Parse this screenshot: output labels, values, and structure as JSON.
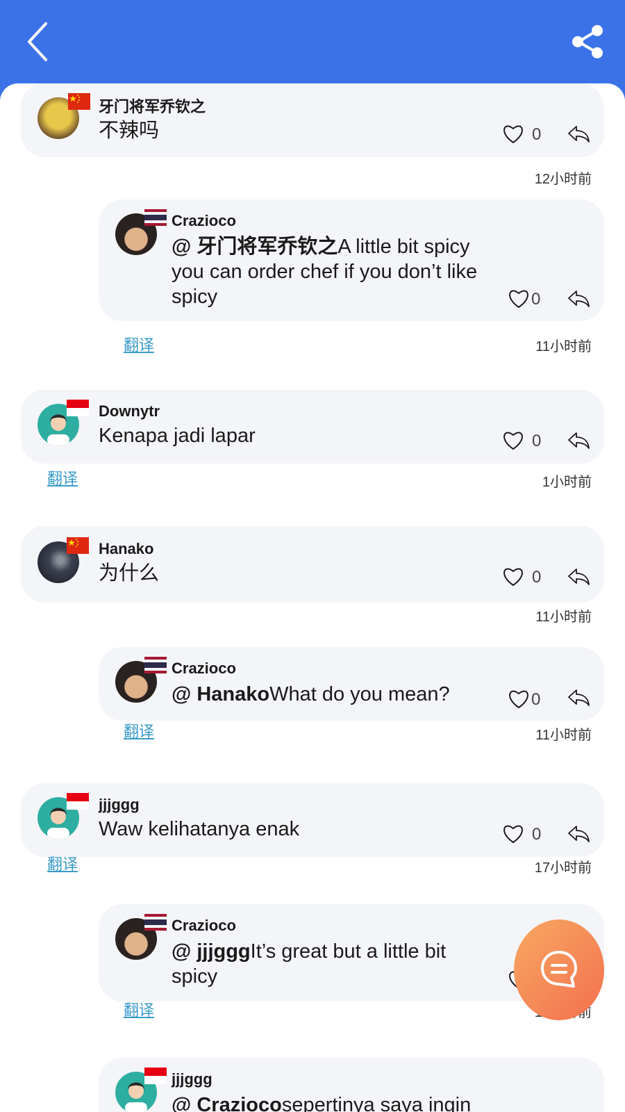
{
  "comments": [
    {
      "username": "牙门将军乔钦之",
      "text": "不辣吗",
      "likes": "0",
      "time": "12小时前"
    },
    {
      "username": "Crazioco",
      "mention": "@ 牙门将军乔钦之",
      "text": "A little bit spicy you can order chef if you don’t like spicy",
      "likes": "0",
      "translate": "翻译",
      "time": "11小时前"
    },
    {
      "username": "Downytr",
      "text": "Kenapa jadi lapar",
      "likes": "0",
      "translate": "翻译",
      "time": "1小时前"
    },
    {
      "username": "Hanako",
      "text": "为什么",
      "likes": "0",
      "time": "11小时前"
    },
    {
      "username": "Crazioco",
      "mention": "@ Hanako",
      "text": "What do you mean?",
      "likes": "0",
      "translate": "翻译",
      "time": "11小时前"
    },
    {
      "username": "jjjggg",
      "text": "Waw kelihatanya enak",
      "likes": "0",
      "translate": "翻译",
      "time": "17小时前"
    },
    {
      "username": "Crazioco",
      "mention": "@ jjjggg",
      "text": "It’s great but a little bit spicy",
      "likes": "0",
      "translate": "翻译",
      "time": "17小时前"
    },
    {
      "username": "jjjggg",
      "mention": "@ Crazioco",
      "text": "sepertinya saya ingin"
    }
  ],
  "colors": {
    "header": "#3b72e8",
    "card": "#f4f5f9",
    "translate_link": "#3a9bc9",
    "fab_start": "#f7a862",
    "fab_end": "#f3704e"
  },
  "icons": {
    "back": "chevron-left-icon",
    "share": "share-icon",
    "like": "heart-icon",
    "reply": "reply-arrow-icon",
    "fab": "chat-bubble-icon"
  }
}
